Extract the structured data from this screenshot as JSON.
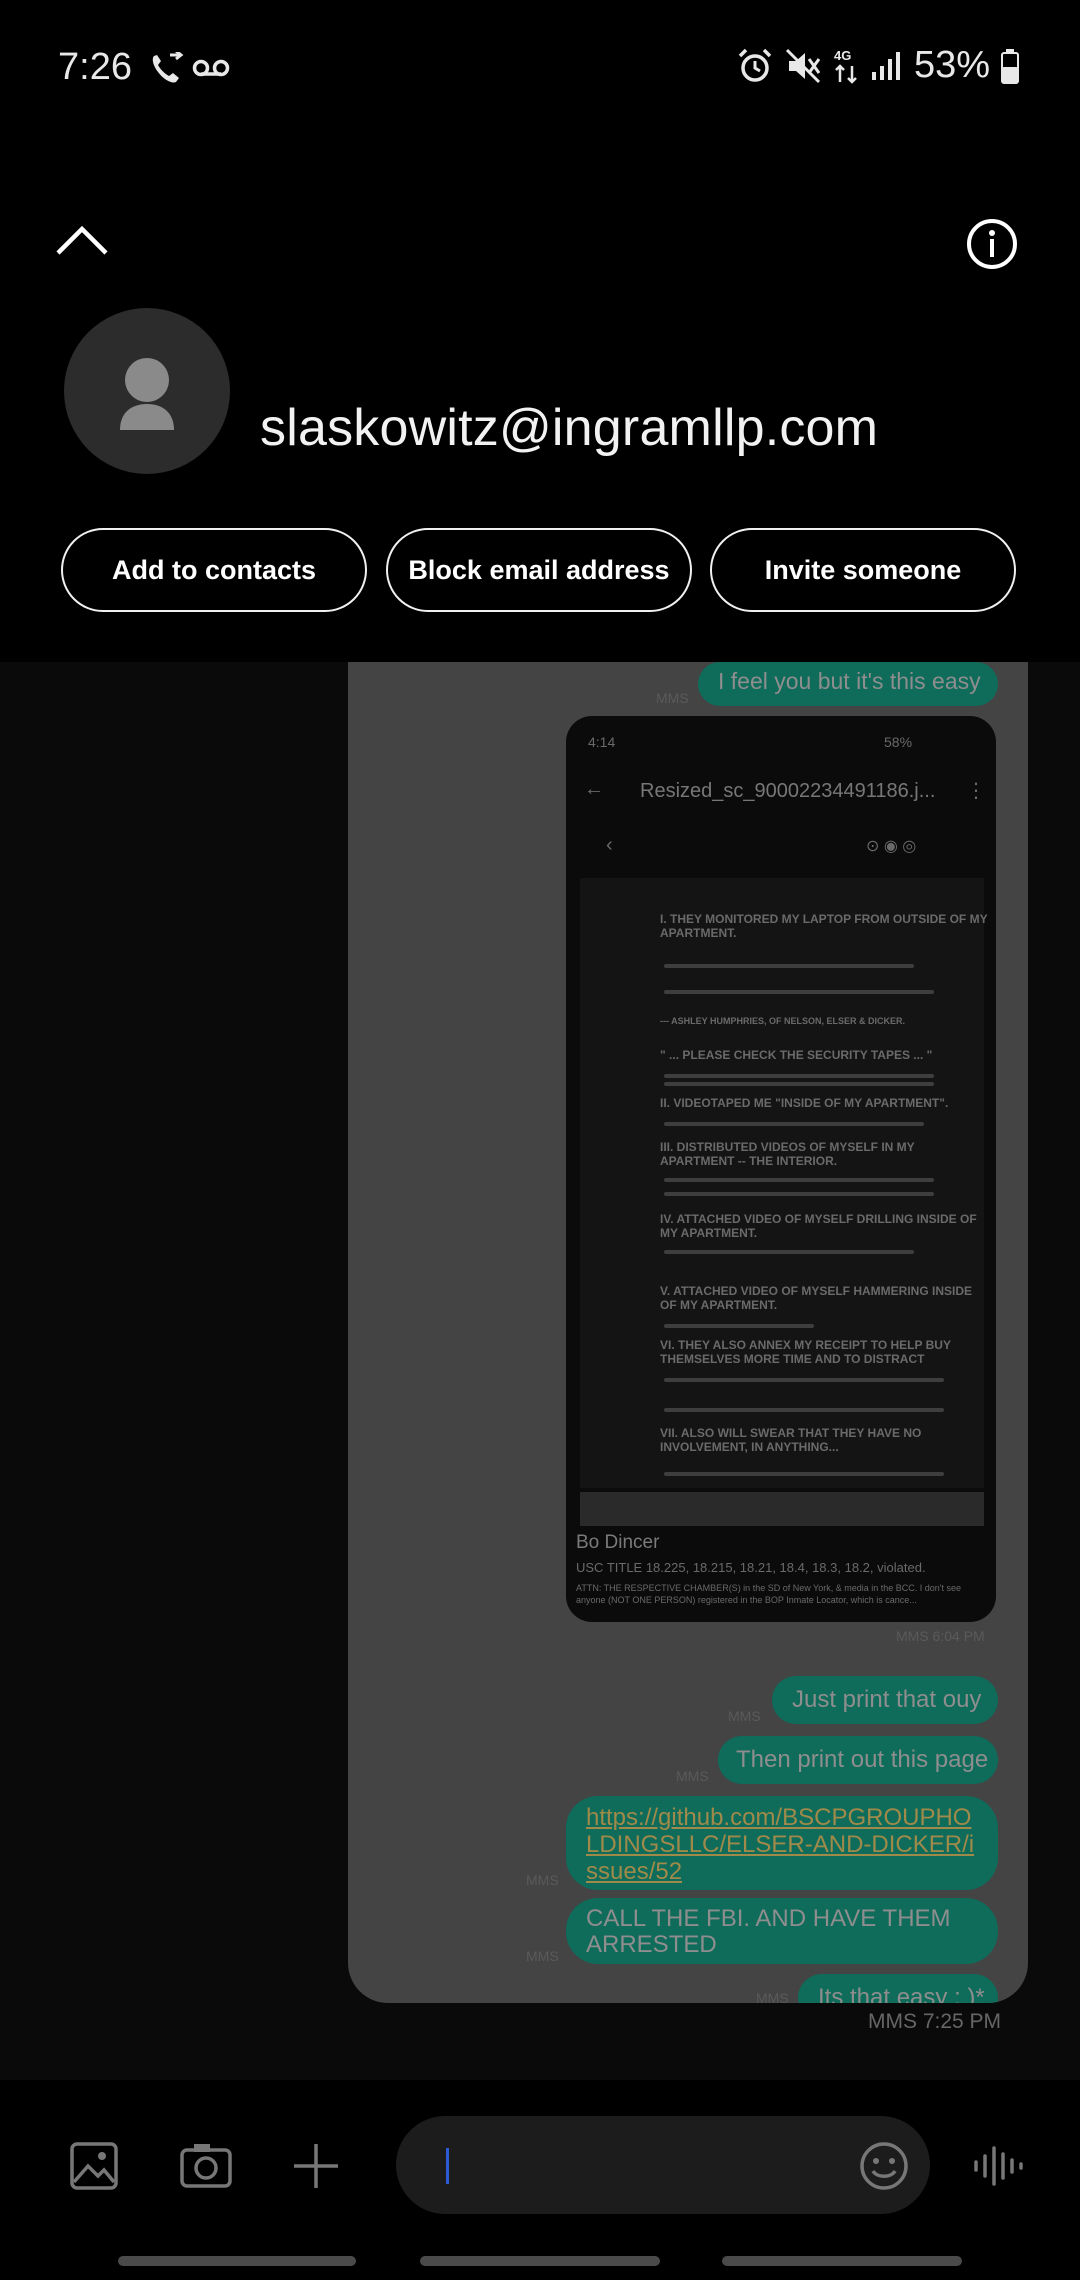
{
  "status_bar": {
    "time": "7:26",
    "battery_percent": "53%",
    "icons": [
      "call-forward-icon",
      "voicemail-icon",
      "alarm-icon",
      "mute-icon",
      "4g-data-icon",
      "signal-icon",
      "battery-icon"
    ]
  },
  "header": {
    "contact_email": "slaskowitz@ingramllp.com",
    "buttons": {
      "add_to_contacts": "Add to contacts",
      "block_email": "Block email address",
      "invite_someone": "Invite someone"
    }
  },
  "preview": {
    "top_bubble": "I feel you but it's this easy",
    "mms_label": "MMS",
    "inner_screenshot": {
      "time": "4:14",
      "battery": "58%",
      "file_title": "Resized_sc_90002234491186.j...",
      "headings": [
        "I.    THEY MONITORED MY LAPTOP FROM OUTSIDE OF MY APARTMENT.",
        "--- ASHLEY HUMPHRIES, OF NELSON, ELSER & DICKER.",
        "\" ... PLEASE CHECK THE SECURITY TAPES ... \"",
        "II.    VIDEOTAPED ME \"INSIDE OF MY APARTMENT\".",
        "III.    DISTRIBUTED VIDEOS OF MYSELF IN MY APARTMENT -- THE INTERIOR.",
        "IV.    ATTACHED VIDEO OF MYSELF DRILLING INSIDE OF MY APARTMENT.",
        "V.    ATTACHED VIDEO OF MYSELF HAMMERING INSIDE OF MY APARTMENT.",
        "VI.    THEY ALSO ANNEX MY RECEIPT TO HELP BUY THEMSELVES MORE TIME AND TO DISTRACT",
        "VII.    ALSO WILL SWEAR THAT THEY HAVE NO INVOLVEMENT, IN ANYTHING..."
      ],
      "caption_name": "Bo Dincer",
      "caption_line1": "USC TITLE 18.225, 18.215, 18.21, 18.4, 18.3, 18.2, violated.",
      "caption_line2": "ATTN: THE RESPECTIVE CHAMBER(S) in the SD of New York, & media in the BCC. I don't see anyone (NOT ONE PERSON) registered in the BOP Inmate Locator, which is cance..."
    },
    "image_timestamp": "MMS 6:04 PM",
    "bubbles": [
      "Just print that ouy",
      "Then print out this page",
      "https://github.com/BSCPGROUPHOLDINGSLLC/ELSER-AND-DICKER/issues/52",
      "CALL THE FBI. AND HAVE THEM ARRESTED",
      "Its that easy : )*"
    ]
  },
  "conversation_timestamp": "MMS 7:25 PM",
  "input_bar": {
    "placeholder": "",
    "icons": [
      "gallery-icon",
      "camera-icon",
      "add-icon",
      "emoji-icon",
      "voice-input-icon"
    ]
  },
  "colors": {
    "bubble": "#0f6b5a",
    "background": "#000000",
    "cursor": "#2d5bd6"
  }
}
